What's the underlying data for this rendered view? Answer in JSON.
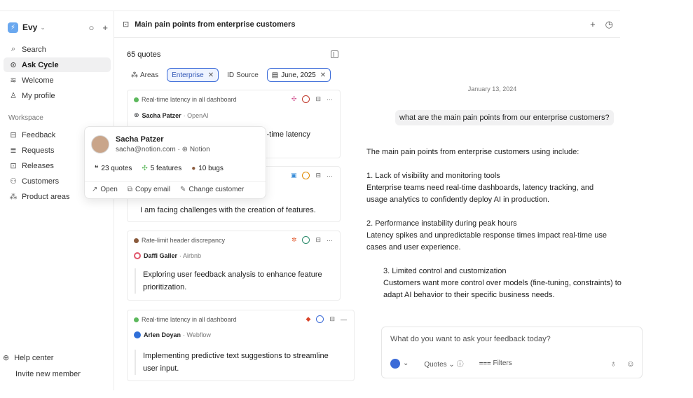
{
  "sidebar": {
    "workspace_name": "Evy",
    "logo_glyph": "⚡",
    "items": [
      {
        "label": "Search",
        "icon": "search-icon",
        "glyph": "⌕"
      },
      {
        "label": "Ask Cycle",
        "icon": "ask-cycle-icon",
        "glyph": "⊙",
        "active": true
      },
      {
        "label": "Welcome",
        "icon": "wave-icon",
        "glyph": "≋"
      },
      {
        "label": "My profile",
        "icon": "user-icon",
        "glyph": "♙"
      }
    ],
    "section_label": "Workspace",
    "workspace_items": [
      {
        "label": "Feedback",
        "icon": "inbox-icon",
        "glyph": "⊟"
      },
      {
        "label": "Requests",
        "icon": "stack-icon",
        "glyph": "≣"
      },
      {
        "label": "Releases",
        "icon": "release-icon",
        "glyph": "⊡"
      },
      {
        "label": "Customers",
        "icon": "users-icon",
        "glyph": "⚇"
      },
      {
        "label": "Product areas",
        "icon": "areas-icon",
        "glyph": "⁂"
      }
    ],
    "help_label": "Help center",
    "invite_label": "Invite new member"
  },
  "header": {
    "title": "Main pain points from enterprise customers"
  },
  "quotes": {
    "count_label": "65 quotes",
    "filters": {
      "areas": "Areas",
      "enterprise": "Enterprise",
      "source": "Source",
      "date": "June, 2025"
    },
    "cards": [
      {
        "tag": "Real-time latency in all dashboard",
        "tag_color": "#5cb85c",
        "author": "Sacha Patzer",
        "company": "· OpenAI",
        "body": "…a real-time latency"
      },
      {
        "body": "I am facing challenges with the creation of features."
      },
      {
        "tag": "Rate-limit header discrepancy",
        "tag_color": "#8a5a3c",
        "author": "Daffi Galler",
        "company": "· Airbnb",
        "body": "Exploring user feedback analysis to enhance feature prioritization."
      },
      {
        "tag": "Real-time latency in all dashboard",
        "tag_color": "#5cb85c",
        "author": "Arlen Doyan",
        "company": "· Webflow",
        "body": "Implementing predictive text suggestions to streamline user input."
      }
    ]
  },
  "popover": {
    "name": "Sacha Patzer",
    "email": "sacha@notion.com",
    "company": "Notion",
    "stats": {
      "quotes": "23 quotes",
      "features": "5 features",
      "bugs": "10 bugs"
    },
    "actions": {
      "open": "Open",
      "copy_email": "Copy email",
      "change_customer": "Change customer"
    }
  },
  "chat": {
    "date": "January 13, 2024",
    "question": "what are the main pain points from our enterprise customers?",
    "intro": "The main pain points from enterprise customers using include:",
    "points": [
      {
        "title": "1. Lack of visibility and monitoring tools",
        "lines": [
          "Enterprise teams need real-time dashboards, latency tracking, and",
          "usage analytics to confidently deploy AI in production."
        ]
      },
      {
        "title": "2. Performance instability during peak hours",
        "lines": [
          "Latency spikes and unpredictable response times impact real-time use",
          "cases and user experience."
        ]
      },
      {
        "title": "3. Limited control and customization",
        "lines": [
          "Customers want more control over models (fine-tuning, constraints) to",
          "adapt AI behavior to their specific business needs."
        ]
      }
    ],
    "composer": {
      "placeholder": "What do you want to ask your feedback today?",
      "quotes_label": "Quotes",
      "filters_label": "Filters"
    }
  }
}
